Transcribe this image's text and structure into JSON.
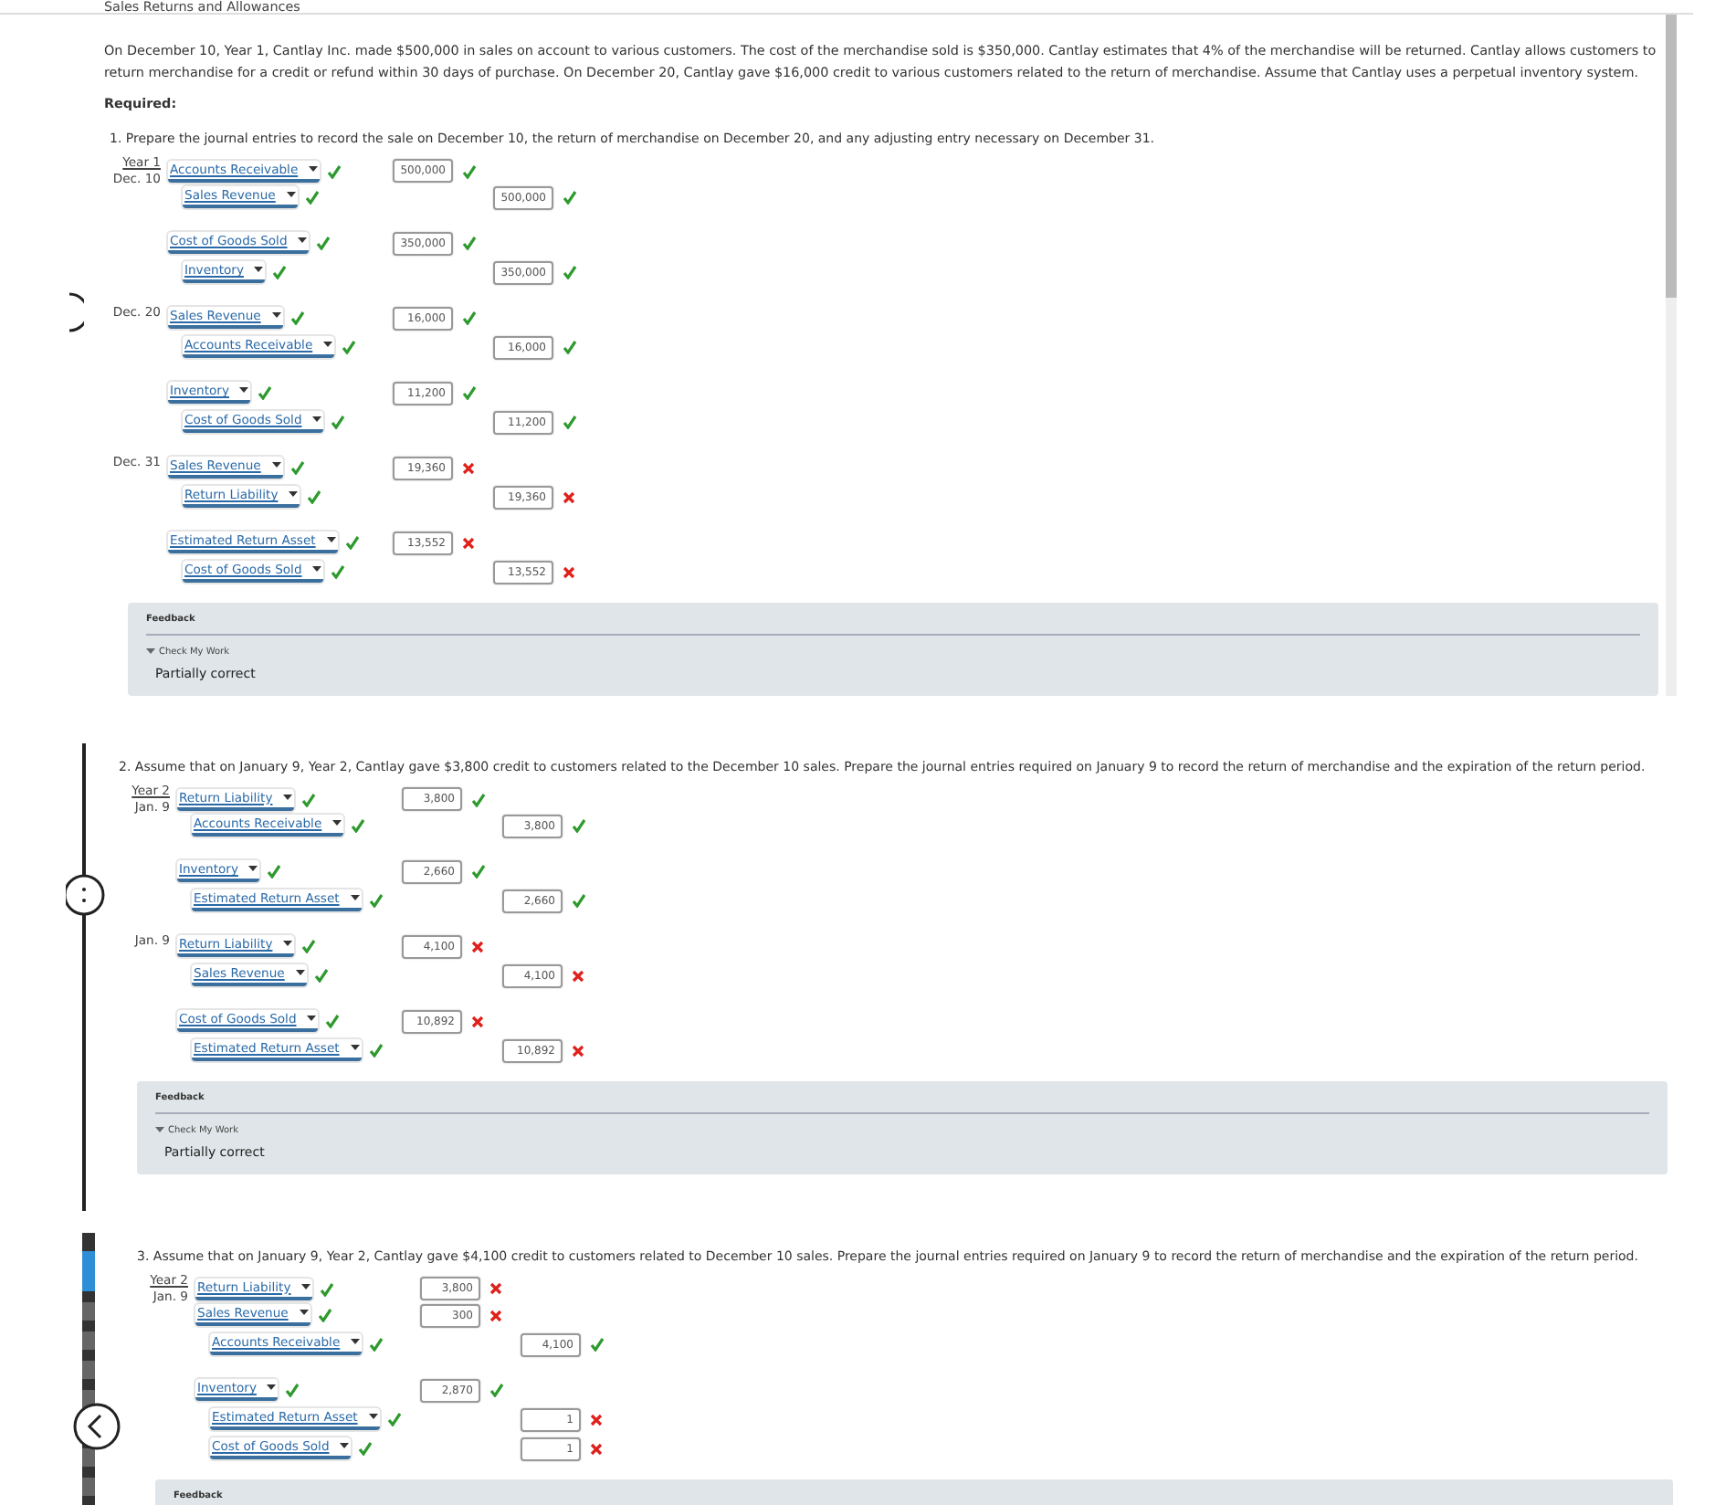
{
  "header": {
    "title": "Sales Returns and Allowances"
  },
  "problem": "On December 10, Year 1, Cantlay Inc. made $500,000 in sales on account to various customers. The cost of the merchandise sold is $350,000. Cantlay estimates that 4% of the merchandise will be returned. Cantlay allows customers to return merchandise for a credit or refund within 30 days of purchase. On December 20, Cantlay gave $16,000 credit to various customers related to the return of merchandise. Assume that Cantlay uses a perpetual inventory system.",
  "required_label": "Required:",
  "parts": [
    {
      "question": "1. Prepare the journal entries to record the sale on December 10, the return of merchandise on December 20, and any adjusting entry necessary on December 31.",
      "entries": [
        {
          "year": "Year 1",
          "date": "Dec. 10",
          "lines": [
            {
              "account": "Accounts Receivable",
              "kind": "debit",
              "account_correct": true,
              "amount": "500,000",
              "amount_correct": true
            },
            {
              "account": "Sales Revenue",
              "kind": "credit",
              "account_correct": true,
              "amount": "500,000",
              "amount_correct": true
            }
          ]
        },
        {
          "lines": [
            {
              "account": "Cost of Goods Sold",
              "kind": "debit",
              "account_correct": true,
              "amount": "350,000",
              "amount_correct": true
            },
            {
              "account": "Inventory",
              "kind": "credit",
              "account_correct": true,
              "amount": "350,000",
              "amount_correct": true
            }
          ]
        },
        {
          "date": "Dec. 20",
          "lines": [
            {
              "account": "Sales Revenue",
              "kind": "debit",
              "account_correct": true,
              "amount": "16,000",
              "amount_correct": true
            },
            {
              "account": "Accounts Receivable",
              "kind": "credit",
              "account_correct": true,
              "amount": "16,000",
              "amount_correct": true
            }
          ]
        },
        {
          "lines": [
            {
              "account": "Inventory",
              "kind": "debit",
              "account_correct": true,
              "amount": "11,200",
              "amount_correct": true
            },
            {
              "account": "Cost of Goods Sold",
              "kind": "credit",
              "account_correct": true,
              "amount": "11,200",
              "amount_correct": true
            }
          ]
        },
        {
          "date": "Dec. 31",
          "lines": [
            {
              "account": "Sales Revenue",
              "kind": "debit",
              "account_correct": true,
              "amount": "19,360",
              "amount_correct": false
            },
            {
              "account": "Return Liability",
              "kind": "credit",
              "account_correct": true,
              "amount": "19,360",
              "amount_correct": false
            }
          ]
        },
        {
          "lines": [
            {
              "account": "Estimated Return Asset",
              "kind": "debit",
              "account_correct": true,
              "amount": "13,552",
              "amount_correct": false
            },
            {
              "account": "Cost of Goods Sold",
              "kind": "credit",
              "account_correct": true,
              "amount": "13,552",
              "amount_correct": false
            }
          ]
        }
      ],
      "feedback": {
        "label": "Feedback",
        "toggle": "Check My Work",
        "result": "Partially correct"
      }
    },
    {
      "question": "2. Assume that on January 9, Year 2, Cantlay gave $3,800 credit to customers related to the December 10 sales. Prepare the journal entries required on January 9 to record the return of merchandise and the expiration of the return period.",
      "entries": [
        {
          "year": "Year 2",
          "date": "Jan. 9",
          "lines": [
            {
              "account": "Return Liability",
              "kind": "debit",
              "account_correct": true,
              "amount": "3,800",
              "amount_correct": true
            },
            {
              "account": "Accounts Receivable",
              "kind": "credit",
              "account_correct": true,
              "amount": "3,800",
              "amount_correct": true
            }
          ]
        },
        {
          "lines": [
            {
              "account": "Inventory",
              "kind": "debit",
              "account_correct": true,
              "amount": "2,660",
              "amount_correct": true
            },
            {
              "account": "Estimated Return Asset",
              "kind": "credit",
              "account_correct": true,
              "amount": "2,660",
              "amount_correct": true
            }
          ]
        },
        {
          "date": "Jan. 9",
          "lines": [
            {
              "account": "Return Liability",
              "kind": "debit",
              "account_correct": true,
              "amount": "4,100",
              "amount_correct": false
            },
            {
              "account": "Sales Revenue",
              "kind": "credit",
              "account_correct": true,
              "amount": "4,100",
              "amount_correct": false
            }
          ]
        },
        {
          "lines": [
            {
              "account": "Cost of Goods Sold",
              "kind": "debit",
              "account_correct": true,
              "amount": "10,892",
              "amount_correct": false
            },
            {
              "account": "Estimated Return Asset",
              "kind": "credit",
              "account_correct": true,
              "amount": "10,892",
              "amount_correct": false
            }
          ]
        }
      ],
      "feedback": {
        "label": "Feedback",
        "toggle": "Check My Work",
        "result": "Partially correct"
      }
    },
    {
      "question": "3. Assume that on January 9, Year 2, Cantlay gave $4,100 credit to customers related to December 10 sales. Prepare the journal entries required on January 9 to record the return of merchandise and the expiration of the return period.",
      "entries": [
        {
          "year": "Year 2",
          "date": "Jan. 9",
          "lines": [
            {
              "account": "Return Liability",
              "kind": "debit",
              "account_correct": true,
              "amount": "3,800",
              "amount_correct": false
            },
            {
              "account": "Sales Revenue",
              "kind": "debit",
              "account_correct": true,
              "amount": "300",
              "amount_correct": false
            },
            {
              "account": "Accounts Receivable",
              "kind": "credit",
              "account_correct": true,
              "amount": "4,100",
              "amount_correct": true
            }
          ]
        },
        {
          "lines": [
            {
              "account": "Inventory",
              "kind": "debit",
              "account_correct": true,
              "amount": "2,870",
              "amount_correct": true
            },
            {
              "account": "Estimated Return Asset",
              "kind": "credit",
              "account_correct": true,
              "amount": "1",
              "amount_correct": false
            },
            {
              "account": "Cost of Goods Sold",
              "kind": "credit",
              "account_correct": true,
              "amount": "1",
              "amount_correct": false
            }
          ]
        }
      ],
      "feedback": {
        "label": "Feedback"
      }
    }
  ]
}
